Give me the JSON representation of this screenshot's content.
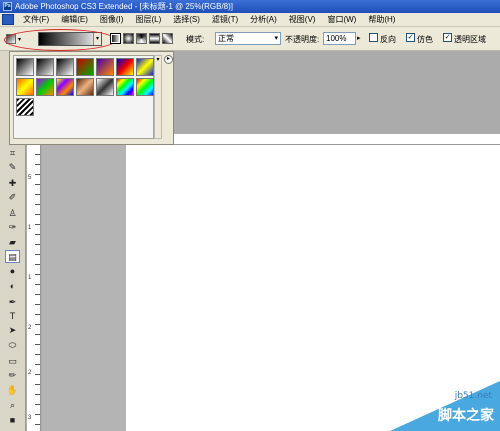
{
  "titlebar": {
    "logo": "Ps",
    "title": "Adobe Photoshop CS3 Extended - [未标题-1 @ 25%(RGB/8)]"
  },
  "menu": [
    "文件(F)",
    "编辑(E)",
    "图像(I)",
    "图层(L)",
    "选择(S)",
    "滤镜(T)",
    "分析(A)",
    "视图(V)",
    "窗口(W)",
    "帮助(H)"
  ],
  "options": {
    "mode_label": "模式:",
    "mode_value": "正常",
    "opacity_label": "不透明度:",
    "opacity_value": "100%",
    "reverse_label": "反向",
    "dither_label": "仿色",
    "transparency_label": "透明区域",
    "reverse_checked": false,
    "dither_checked": true,
    "transparency_checked": true
  },
  "gradient_swatches": [
    {
      "name": "foreground-to-background",
      "css": "linear-gradient(135deg,#000,#fff)"
    },
    {
      "name": "foreground-to-transparent",
      "css": "linear-gradient(135deg,#000,#f0f0f0)"
    },
    {
      "name": "black-white",
      "css": "linear-gradient(135deg,#000,#fff)"
    },
    {
      "name": "red-green",
      "css": "linear-gradient(135deg,#c00,#0a0)"
    },
    {
      "name": "violet-orange",
      "css": "linear-gradient(135deg,#40a,#f80)"
    },
    {
      "name": "blue-red-yellow",
      "css": "linear-gradient(135deg,#00c,#e00,#ff0)"
    },
    {
      "name": "blue-yellow-blue",
      "css": "linear-gradient(135deg,#12c,#ff0,#12c)"
    },
    {
      "name": "orange-yellow-orange",
      "css": "linear-gradient(135deg,#f60,#ff0,#f60)"
    },
    {
      "name": "violet-green-orange",
      "css": "linear-gradient(135deg,#a0f,#0c0,#f80)"
    },
    {
      "name": "yellow-violet-orange-blue",
      "css": "linear-gradient(135deg,#ff0,#80f,#f80,#00f)"
    },
    {
      "name": "copper",
      "css": "linear-gradient(135deg,#5a2e10,#f0b080,#5a2e10)"
    },
    {
      "name": "chrome",
      "css": "linear-gradient(135deg,#fff,#333 50%,#fff)"
    },
    {
      "name": "spectrum",
      "css": "linear-gradient(135deg,red,yellow,lime,cyan,blue,magenta)"
    },
    {
      "name": "transparent-rainbow",
      "css": "linear-gradient(135deg,#f00,#ff0,#0f0,#0ff,#00f)"
    },
    {
      "name": "transparent-stripes",
      "css": "repeating-linear-gradient(135deg,#000 0 2px,#fff 2px 4px)"
    }
  ],
  "ruler_numbers": [
    "5",
    "1",
    "1",
    "2",
    "2",
    "3"
  ],
  "watermark": {
    "site": "jb51.net",
    "text": "脚本之家"
  }
}
